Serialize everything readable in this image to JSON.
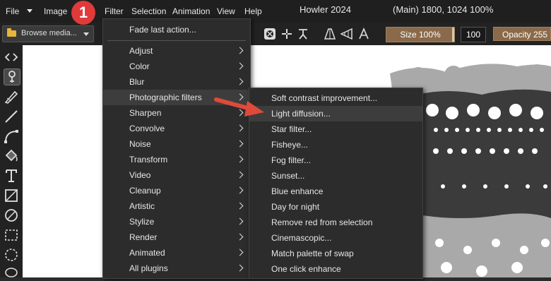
{
  "menubar": {
    "file": "File",
    "image": "Image",
    "filter": "Filter",
    "selection": "Selection",
    "animation": "Animation",
    "view": "View",
    "help": "Help",
    "app_title": "Howler 2024",
    "doc_info": "(Main)  1800, 1024  100%"
  },
  "callout_badge": "1",
  "toolbar": {
    "browse_label": "Browse media...",
    "size_label": "Size 100%",
    "number_value": "100",
    "opacity_label": "Opacity 255"
  },
  "filter_menu": {
    "items": [
      {
        "label": "Fade last action...",
        "submenu": false
      },
      {
        "label": "Adjust",
        "submenu": true
      },
      {
        "label": "Color",
        "submenu": true
      },
      {
        "label": "Blur",
        "submenu": true
      },
      {
        "label": "Photographic filters",
        "submenu": true
      },
      {
        "label": "Sharpen",
        "submenu": true
      },
      {
        "label": "Convolve",
        "submenu": true
      },
      {
        "label": "Noise",
        "submenu": true
      },
      {
        "label": "Transform",
        "submenu": true
      },
      {
        "label": "Video",
        "submenu": true
      },
      {
        "label": "Cleanup",
        "submenu": true
      },
      {
        "label": "Artistic",
        "submenu": true
      },
      {
        "label": "Stylize",
        "submenu": true
      },
      {
        "label": "Render",
        "submenu": true
      },
      {
        "label": "Animated",
        "submenu": true
      },
      {
        "label": "All plugins",
        "submenu": true
      }
    ]
  },
  "photo_submenu": {
    "items": [
      "Soft contrast improvement...",
      "Light diffusion...",
      "Star filter...",
      "Fisheye...",
      "Fog filter...",
      "Sunset...",
      "Blue enhance",
      "Day for night",
      "Remove red from selection",
      "Cinemascopic...",
      "Match palette of swap",
      "One click enhance"
    ]
  },
  "colors": {
    "menu_bg": "#2c2c2c",
    "highlight": "#3d3d3d",
    "accent_brown": "#8a6a4a",
    "badge_red": "#e03a3a",
    "arrow_red": "#e04a3a"
  }
}
